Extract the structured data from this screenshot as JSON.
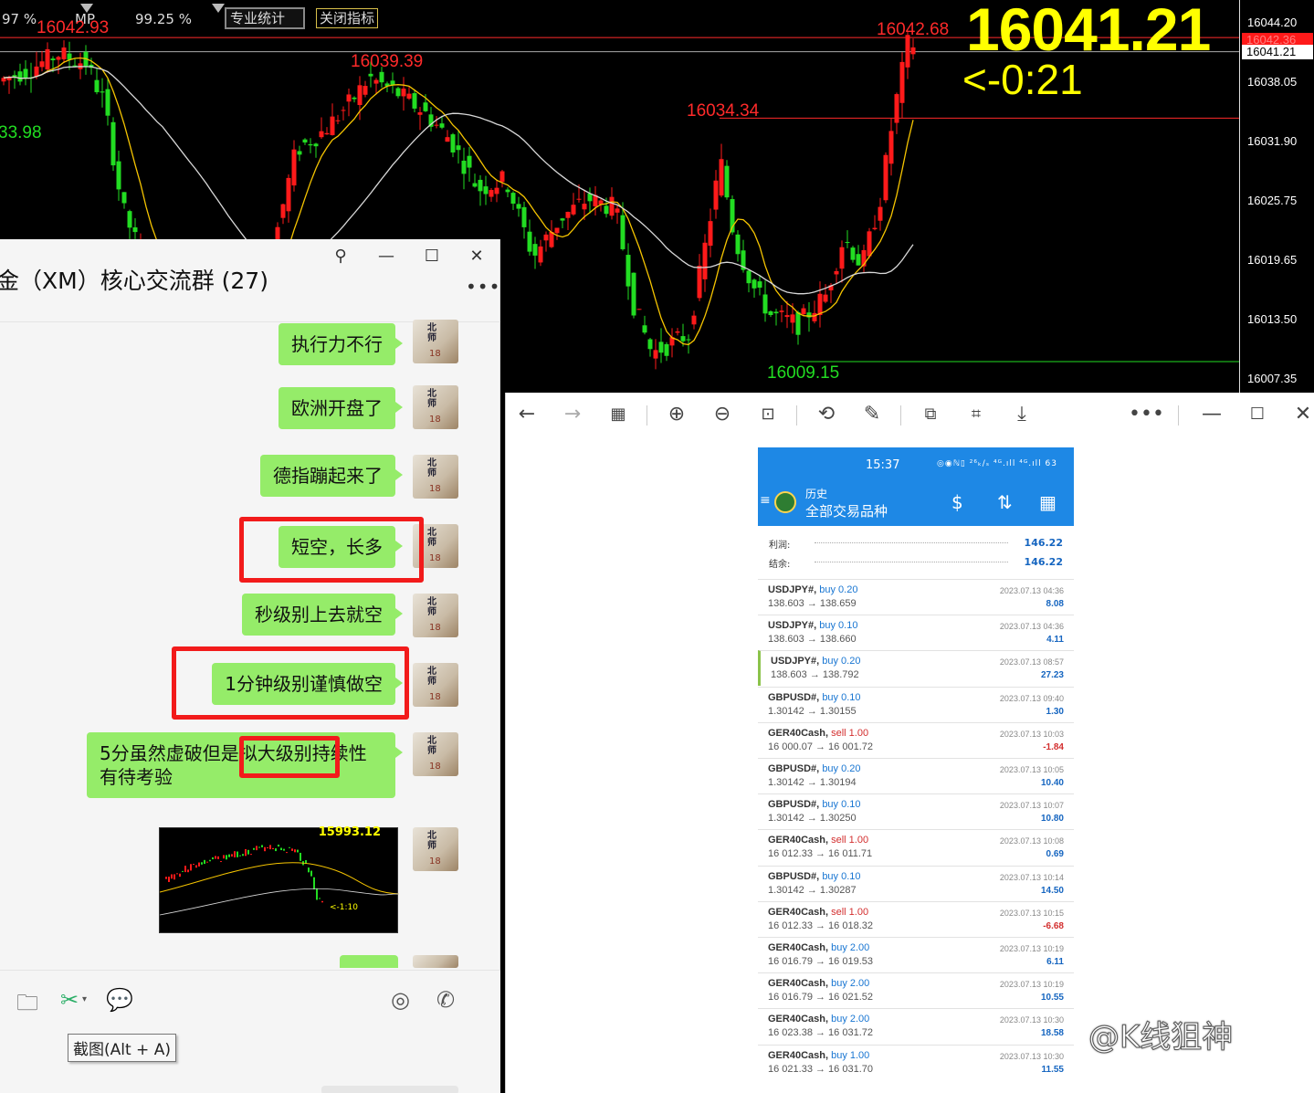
{
  "chart": {
    "toolbar": {
      "pct1": "97 %",
      "mp": "MP",
      "pct2": "99.25 %",
      "stats_label": "专业统计",
      "close_indicator": "关闭指标"
    },
    "big_price": "16041.21",
    "countdown": "<-0:21",
    "labels": {
      "high_left": "16042.93",
      "high_right": "16042.68",
      "mid_high": "16039.39",
      "swing_high": "16034.34",
      "low": "16009.15",
      "left_green": "33.98"
    },
    "axis_ticks": [
      "16044.20",
      "16038.05",
      "16031.90",
      "16025.75",
      "16019.65",
      "16013.50",
      "16007.35"
    ],
    "axis_current_red": "16042.36",
    "axis_current": "16041.21",
    "colors": {
      "bull": "#ff1a1a",
      "bear": "#22dd22",
      "ma_fast": "#f5c400",
      "ma_slow": "#d8d8d8",
      "price_big": "#ffff00"
    }
  },
  "chat": {
    "title": "金（XM）核心交流群 (27)",
    "messages": [
      "执行力不行",
      "欧洲开盘了",
      "德指蹦起来了",
      "短空，长多",
      "秒级别上去就空",
      "1分钟级别谨慎做空",
      "5分虽然虚破但是拟大级别持续性",
      "有待考验"
    ],
    "thumb_price": "15993.12",
    "thumb_count": "<-1:10",
    "avatar_text": "18",
    "tooltip": "截图(Alt + A)"
  },
  "phone": {
    "time": "15:37",
    "status": "◎◉ℕ▯ ²⁶ₖ/ₛ ⁴ᴳ.ıll ⁴ᴳ.ıll 63",
    "title1": "历史",
    "title2": "全部交易品种",
    "profit_label": "利润:",
    "profit_value": "146.22",
    "balance_label": "结余:",
    "balance_value": "146.22",
    "trades": [
      {
        "sym": "USDJPY#,",
        "side": "buy 0.20",
        "px": "138.603 → 138.659",
        "dt": "2023.07.13 04:36",
        "pl": "8.08",
        "type": "buy"
      },
      {
        "sym": "USDJPY#,",
        "side": "buy 0.10",
        "px": "138.603 → 138.660",
        "dt": "2023.07.13 04:36",
        "pl": "4.11",
        "type": "buy"
      },
      {
        "sym": "USDJPY#,",
        "side": "buy 0.20",
        "px": "138.603 → 138.792",
        "dt": "2023.07.13 08:57",
        "pl": "27.23",
        "type": "buy"
      },
      {
        "sym": "GBPUSD#,",
        "side": "buy 0.10",
        "px": "1.30142 → 1.30155",
        "dt": "2023.07.13 09:40",
        "pl": "1.30",
        "type": "buy"
      },
      {
        "sym": "GER40Cash,",
        "side": "sell 1.00",
        "px": "16 000.07 → 16 001.72",
        "dt": "2023.07.13 10:03",
        "pl": "-1.84",
        "type": "sell"
      },
      {
        "sym": "GBPUSD#,",
        "side": "buy 0.20",
        "px": "1.30142 → 1.30194",
        "dt": "2023.07.13 10:05",
        "pl": "10.40",
        "type": "buy"
      },
      {
        "sym": "GBPUSD#,",
        "side": "buy 0.10",
        "px": "1.30142 → 1.30250",
        "dt": "2023.07.13 10:07",
        "pl": "10.80",
        "type": "buy"
      },
      {
        "sym": "GER40Cash,",
        "side": "sell 1.00",
        "px": "16 012.33 → 16 011.71",
        "dt": "2023.07.13 10:08",
        "pl": "0.69",
        "type": "sell"
      },
      {
        "sym": "GBPUSD#,",
        "side": "buy 0.10",
        "px": "1.30142 → 1.30287",
        "dt": "2023.07.13 10:14",
        "pl": "14.50",
        "type": "buy"
      },
      {
        "sym": "GER40Cash,",
        "side": "sell 1.00",
        "px": "16 012.33 → 16 018.32",
        "dt": "2023.07.13 10:15",
        "pl": "-6.68",
        "type": "sell"
      },
      {
        "sym": "GER40Cash,",
        "side": "buy 2.00",
        "px": "16 016.79 → 16 019.53",
        "dt": "2023.07.13 10:19",
        "pl": "6.11",
        "type": "buy"
      },
      {
        "sym": "GER40Cash,",
        "side": "buy 2.00",
        "px": "16 016.79 → 16 021.52",
        "dt": "2023.07.13 10:19",
        "pl": "10.55",
        "type": "buy"
      },
      {
        "sym": "GER40Cash,",
        "side": "buy 2.00",
        "px": "16 023.38 → 16 031.72",
        "dt": "2023.07.13 10:30",
        "pl": "18.58",
        "type": "buy"
      },
      {
        "sym": "GER40Cash,",
        "side": "buy 1.00",
        "px": "16 021.33 → 16 031.70",
        "dt": "2023.07.13 10:30",
        "pl": "11.55",
        "type": "buy"
      }
    ]
  },
  "watermark": "@K线狙神"
}
